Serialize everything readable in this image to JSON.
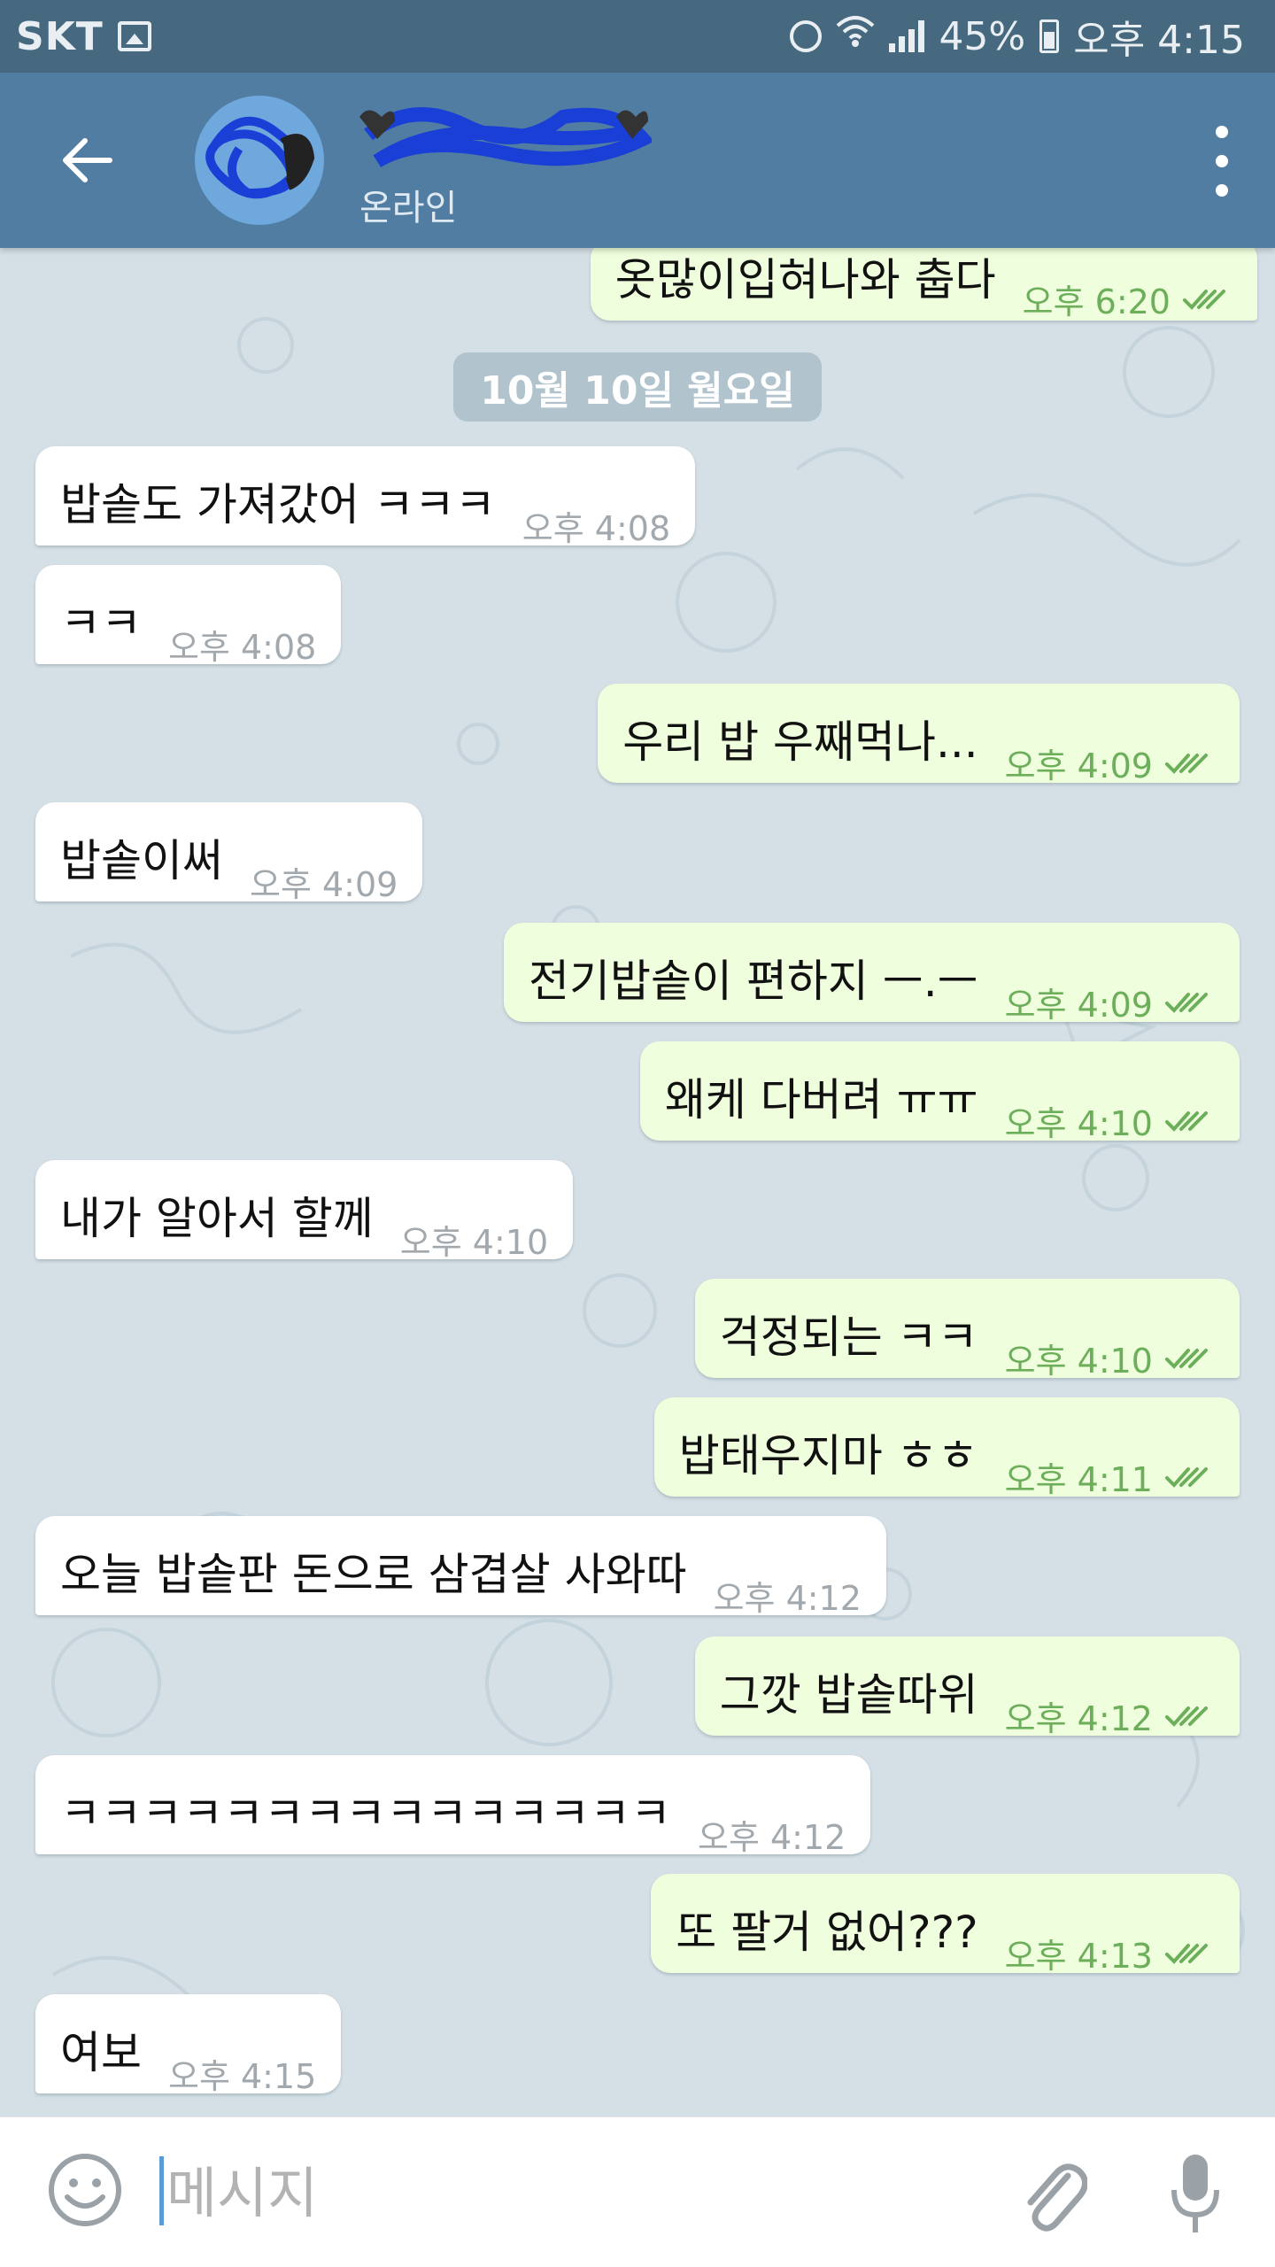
{
  "status_bar": {
    "carrier": "SKT",
    "battery": "45%",
    "time": "오후 4:15"
  },
  "header": {
    "status": "온라인"
  },
  "chat": {
    "date_separator": "10월 10일 월요일",
    "messages": [
      {
        "dir": "out",
        "text": "옷많이입혀나와 춥다",
        "time": "오후 6:20"
      },
      {
        "dir": "in",
        "text": "밥솥도 가져갔어 ㅋㅋㅋ",
        "time": "오후 4:08"
      },
      {
        "dir": "in",
        "text": "ㅋㅋ",
        "time": "오후 4:08"
      },
      {
        "dir": "out",
        "text": "우리 밥 우째먹나...",
        "time": "오후 4:09"
      },
      {
        "dir": "in",
        "text": "밥솥이써",
        "time": "오후 4:09"
      },
      {
        "dir": "out",
        "text": "전기밥솥이 편하지 ㅡ.ㅡ",
        "time": "오후 4:09"
      },
      {
        "dir": "out",
        "text": "왜케 다버려 ㅠㅠ",
        "time": "오후 4:10"
      },
      {
        "dir": "in",
        "text": "내가 알아서 할께",
        "time": "오후 4:10"
      },
      {
        "dir": "out",
        "text": "걱정되는 ㅋㅋ",
        "time": "오후 4:10"
      },
      {
        "dir": "out",
        "text": "밥태우지마 ㅎㅎ",
        "time": "오후 4:11"
      },
      {
        "dir": "in",
        "text": "오늘 밥솥판 돈으로 삼겹살 사와따",
        "time": "오후 4:12"
      },
      {
        "dir": "out",
        "text": "그깟 밥솥따위",
        "time": "오후 4:12"
      },
      {
        "dir": "in",
        "text": "ㅋㅋㅋㅋㅋㅋㅋㅋㅋㅋㅋㅋㅋㅋㅋ",
        "time": "오후 4:12"
      },
      {
        "dir": "out",
        "text": "또 팔거 없어???",
        "time": "오후 4:13"
      },
      {
        "dir": "in",
        "text": "여보",
        "time": "오후 4:15"
      }
    ]
  },
  "input": {
    "placeholder": "메시지"
  },
  "colors": {
    "header": "#527da3",
    "status_bar": "#46697f",
    "outgoing_bubble": "#effedd",
    "incoming_bubble": "#ffffff",
    "outgoing_time": "#6cae5a",
    "scribble": "#1a3fd6"
  },
  "icons": {
    "back": "arrow-left-icon",
    "menu": "more-vertical-icon",
    "emoji": "smiley-icon",
    "attach": "paperclip-icon",
    "mic": "microphone-icon",
    "read": "double-check-icon"
  }
}
